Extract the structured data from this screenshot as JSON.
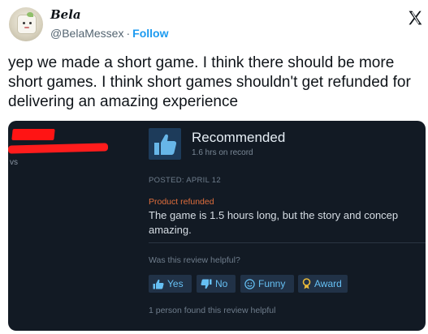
{
  "tweet": {
    "display_name": "Bela",
    "handle": "@BelaMessex",
    "separator": "·",
    "follow_label": "Follow",
    "text": "yep we made a short game. I think there should be more short games. I think short games shouldn't get refunded for delivering an amazing experience",
    "platform_icon": "x-logo-icon"
  },
  "review": {
    "left_fragment": "vs",
    "rating": "Recommended",
    "hours": "1.6 hrs on record",
    "posted": "POSTED: APRIL 12",
    "refund_status": "Product refunded",
    "body_line1": "The game is 1.5 hours long, but the story and concep",
    "body_line2": "amazing.",
    "helpful_question": "Was this review helpful?",
    "buttons": {
      "yes": "Yes",
      "no": "No",
      "funny": "Funny",
      "award": "Award"
    },
    "found_helpful": "1 person found this review helpful"
  },
  "colors": {
    "card_bg": "#121a24",
    "button_bg": "#213247",
    "button_text": "#66c0f4",
    "refund_orange": "#e06e3c",
    "redaction_red": "#ff1414",
    "follow_blue": "#1d9bf0"
  }
}
